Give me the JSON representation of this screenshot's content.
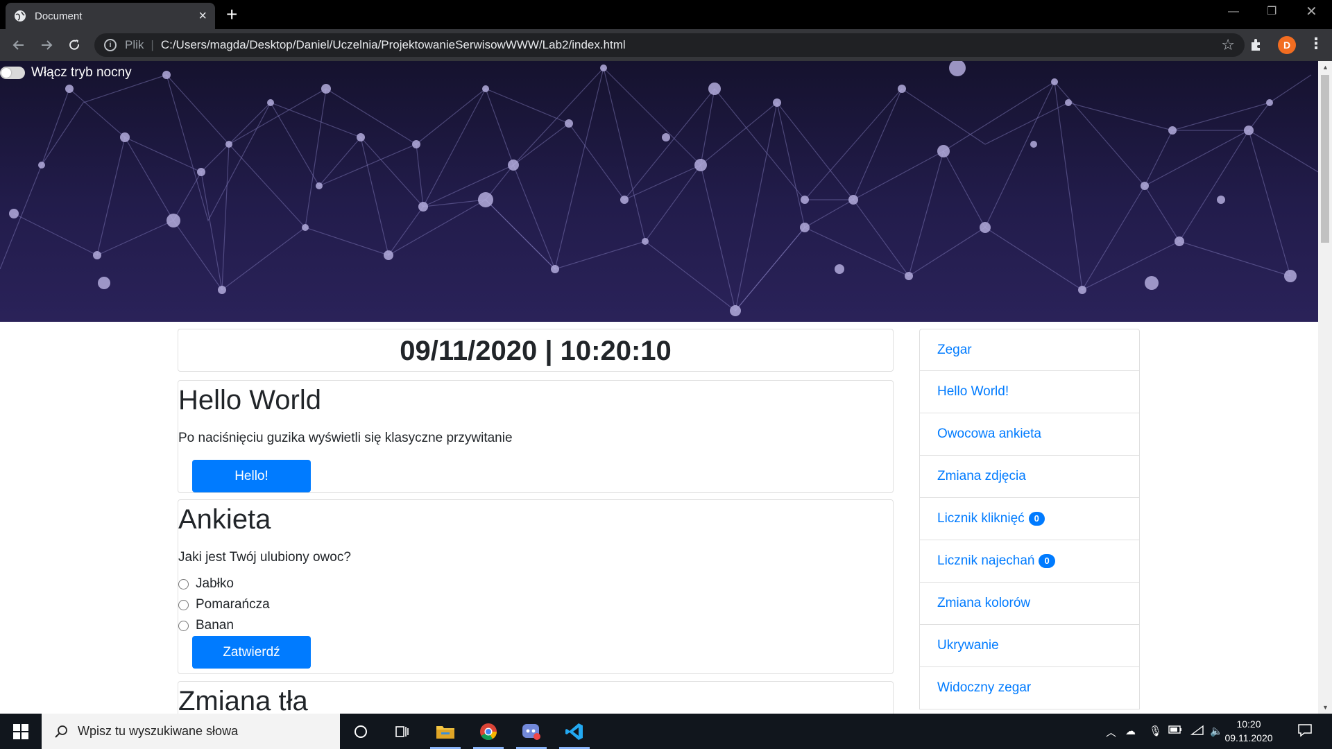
{
  "browser": {
    "tab_title": "Document",
    "address_scheme": "Plik",
    "address_url": "C:/Users/magda/Desktop/Daniel/Uczelnia/ProjektowanieSerwisowWWW/Lab2/index.html",
    "profile_initial": "D"
  },
  "page": {
    "night_mode_label": "Włącz tryb nocny",
    "clock_text": "09/11/2020 | 10:20:10",
    "hello": {
      "title": "Hello World",
      "desc": "Po naciśnięciu guzika wyświetli się klasyczne przywitanie",
      "button": "Hello!"
    },
    "ankieta": {
      "title": "Ankieta",
      "question": "Jaki jest Twój ulubiony owoc?",
      "options": [
        "Jabłko",
        "Pomarańcza",
        "Banan"
      ],
      "button": "Zatwierdź"
    },
    "zmiana_tla": {
      "title": "Zmiana tła"
    },
    "nav": [
      {
        "label": "Zegar"
      },
      {
        "label": "Hello World!"
      },
      {
        "label": "Owocowa ankieta"
      },
      {
        "label": "Zmiana zdjęcia"
      },
      {
        "label": "Licznik kliknięć",
        "badge": "0"
      },
      {
        "label": "Licznik najechań",
        "badge": "0"
      },
      {
        "label": "Zmiana kolorów"
      },
      {
        "label": "Ukrywanie"
      },
      {
        "label": "Widoczny zegar"
      }
    ],
    "accent_color": "#007bff"
  },
  "taskbar": {
    "search_placeholder": "Wpisz tu wyszukiwane słowa",
    "time": "10:20",
    "date": "09.11.2020"
  }
}
